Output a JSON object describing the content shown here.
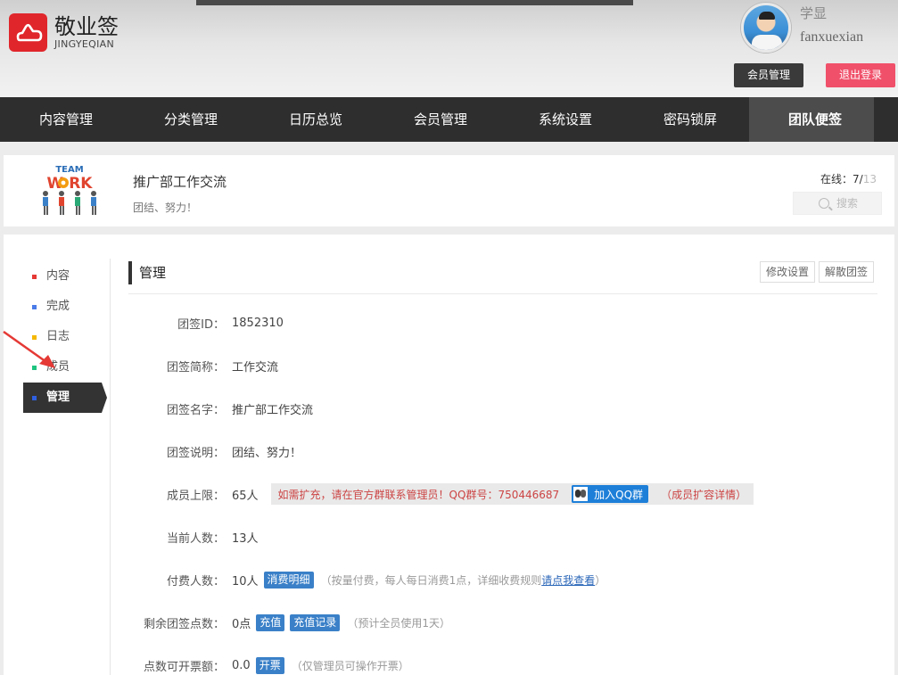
{
  "brand": {
    "name_cn": "敬业签",
    "name_en": "JINGYEQIAN"
  },
  "user": {
    "nickname": "学显",
    "username": "fanxuexian",
    "member_btn": "会员管理",
    "logout_btn": "退出登录"
  },
  "nav": [
    {
      "label": "内容管理"
    },
    {
      "label": "分类管理"
    },
    {
      "label": "日历总览"
    },
    {
      "label": "会员管理"
    },
    {
      "label": "系统设置"
    },
    {
      "label": "密码锁屏"
    },
    {
      "label": "团队便签"
    }
  ],
  "team": {
    "name": "推广部工作交流",
    "slogan": "团结、努力！",
    "online_label": "在线：",
    "online_count": "7",
    "online_total": "13",
    "search_placeholder": "搜索"
  },
  "sidebar": [
    {
      "label": "内容",
      "color": "#e53935"
    },
    {
      "label": "完成",
      "color": "#4a7be8"
    },
    {
      "label": "日志",
      "color": "#f5b800"
    },
    {
      "label": "成员",
      "color": "#1ec47e"
    },
    {
      "label": "管理",
      "color": "#2f5fe0"
    }
  ],
  "section": {
    "title": "管理",
    "edit_btn": "修改设置",
    "dissolve_btn": "解散团签"
  },
  "fields": {
    "id": {
      "label": "团签ID：",
      "value": "1852310"
    },
    "short_name": {
      "label": "团签简称：",
      "value": "工作交流"
    },
    "name": {
      "label": "团签名字：",
      "value": "推广部工作交流"
    },
    "desc": {
      "label": "团签说明：",
      "value": "团结、努力！"
    },
    "limit": {
      "label": "成员上限：",
      "value": "65人",
      "notice": "如需扩充，请在官方群联系管理员！QQ群号：750446687",
      "qq_btn": "加入QQ群",
      "detail": "（成员扩容详情）"
    },
    "current": {
      "label": "当前人数：",
      "value": "13人"
    },
    "paid": {
      "label": "付费人数：",
      "value": "10人",
      "tag": "消费明细",
      "hint": "（按量付费，每人每日消费1点，详细收费规则",
      "link": "请点我查看",
      "hint_end": "）"
    },
    "points": {
      "label": "剩余团签点数：",
      "value": "0点",
      "tag1": "充值",
      "tag2": "充值记录",
      "hint": "（预计全员使用1天）"
    },
    "invoice": {
      "label": "点数可开票额：",
      "value": "0.0",
      "tag": "开票",
      "hint": "（仅管理员可操作开票）"
    }
  }
}
